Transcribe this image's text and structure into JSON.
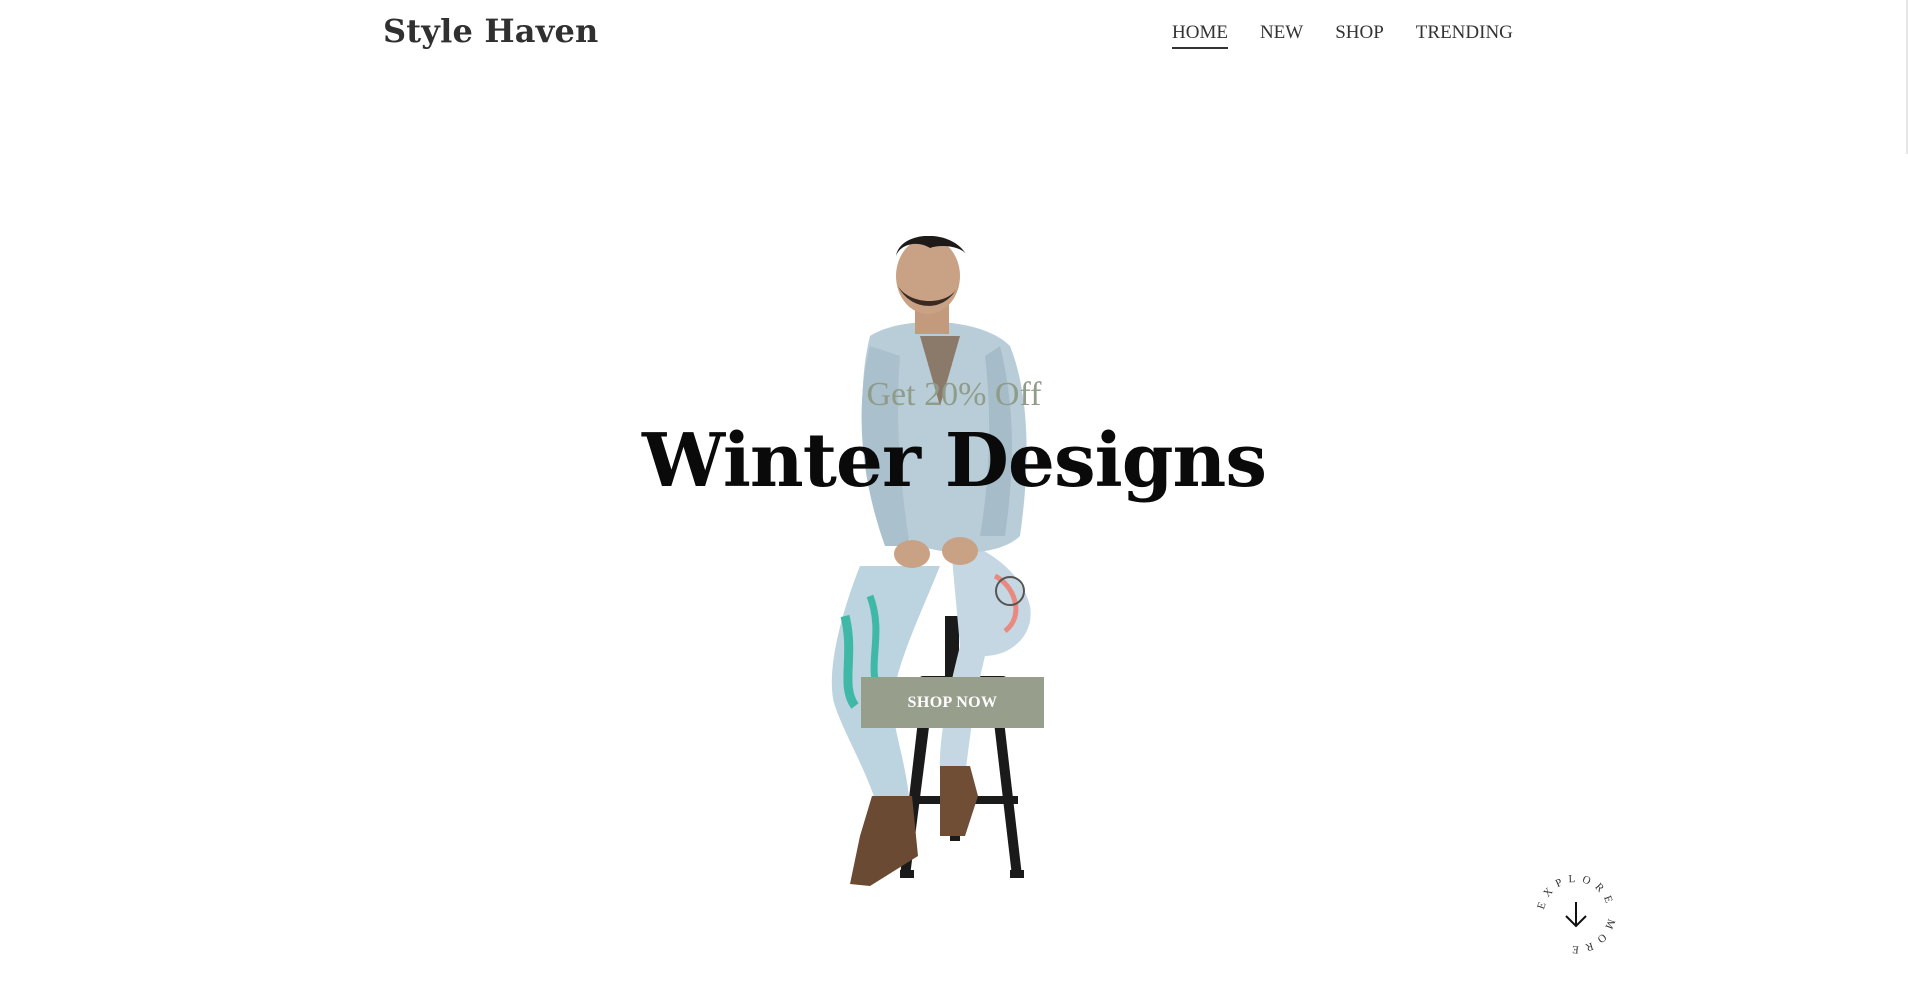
{
  "brand": {
    "name": "Style Haven"
  },
  "nav": {
    "items": [
      {
        "label": "HOME",
        "active": true
      },
      {
        "label": "NEW",
        "active": false
      },
      {
        "label": "SHOP",
        "active": false
      },
      {
        "label": "TRENDING",
        "active": false
      }
    ]
  },
  "hero": {
    "eyebrow": "Get 20% Off",
    "headline": "Winter Designs",
    "cta_label": "SHOP NOW",
    "image_icon": "model-on-stool-image"
  },
  "explore": {
    "label": "EXPLORE MORE",
    "icon": "arrow-down-icon"
  },
  "colors": {
    "accent": "#979f8c",
    "eyebrow": "#8f9d88",
    "text": "#303030"
  }
}
